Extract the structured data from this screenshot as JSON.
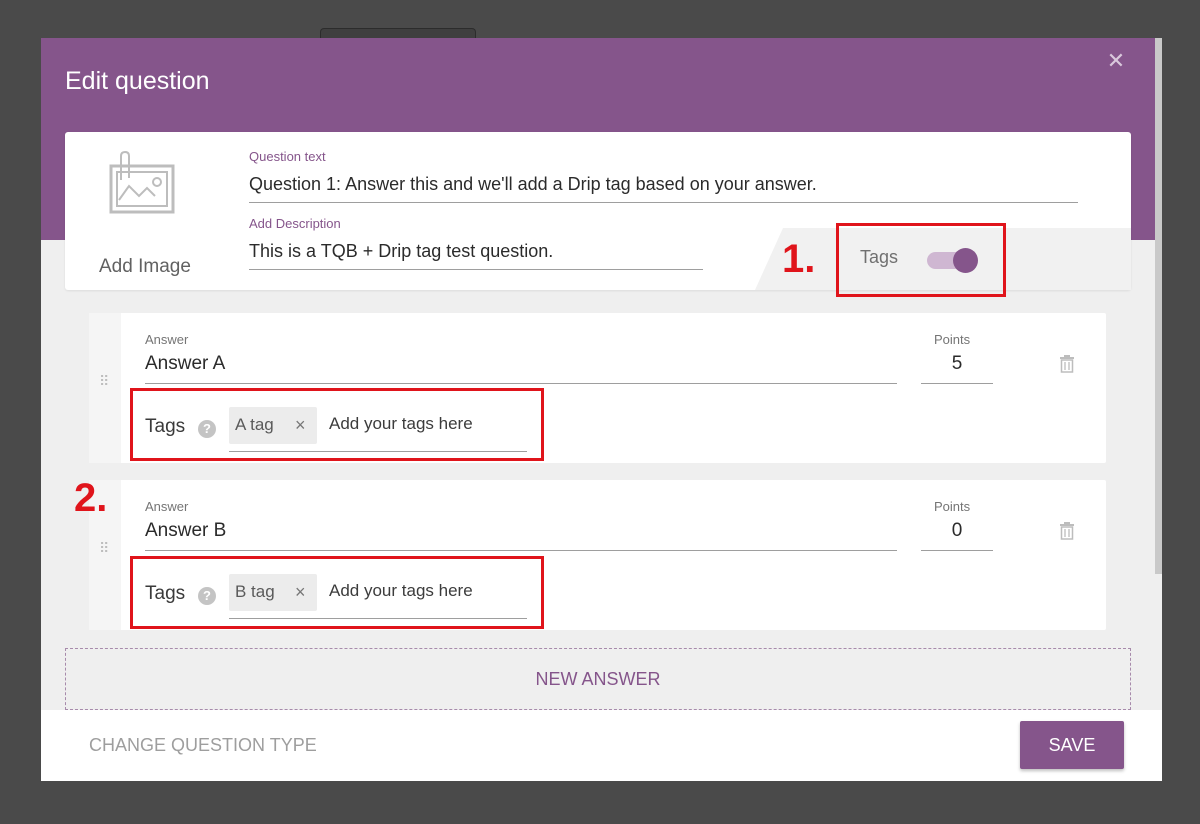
{
  "modal": {
    "title": "Edit question",
    "close_icon": "close-icon",
    "colors": {
      "accent": "#85558b",
      "annotation_red": "#e0141b"
    }
  },
  "question": {
    "add_image_label": "Add Image",
    "image_icon": "image-placeholder-icon",
    "text_label": "Question text",
    "text_value": "Question 1: Answer this and we'll add a Drip tag based on your answer.",
    "description_label": "Add Description",
    "description_value": "This is a TQB + Drip tag test question.",
    "tags_toggle_label": "Tags",
    "tags_toggle_on": true
  },
  "annotations": {
    "marker1": "1.",
    "marker2": "2."
  },
  "answers": [
    {
      "answer_label": "Answer",
      "answer_value": "Answer A",
      "points_label": "Points",
      "points_value": "5",
      "tags_label": "Tags",
      "help_icon_text": "?",
      "chip_text": "A tag",
      "chip_remove": "×",
      "tags_placeholder": "Add your tags here"
    },
    {
      "answer_label": "Answer",
      "answer_value": "Answer B",
      "points_label": "Points",
      "points_value": "0",
      "tags_label": "Tags",
      "help_icon_text": "?",
      "chip_text": "B tag",
      "chip_remove": "×",
      "tags_placeholder": "Add your tags here"
    }
  ],
  "new_answer_label": "NEW ANSWER",
  "footer": {
    "change_type_label": "CHANGE QUESTION TYPE",
    "save_label": "SAVE"
  }
}
